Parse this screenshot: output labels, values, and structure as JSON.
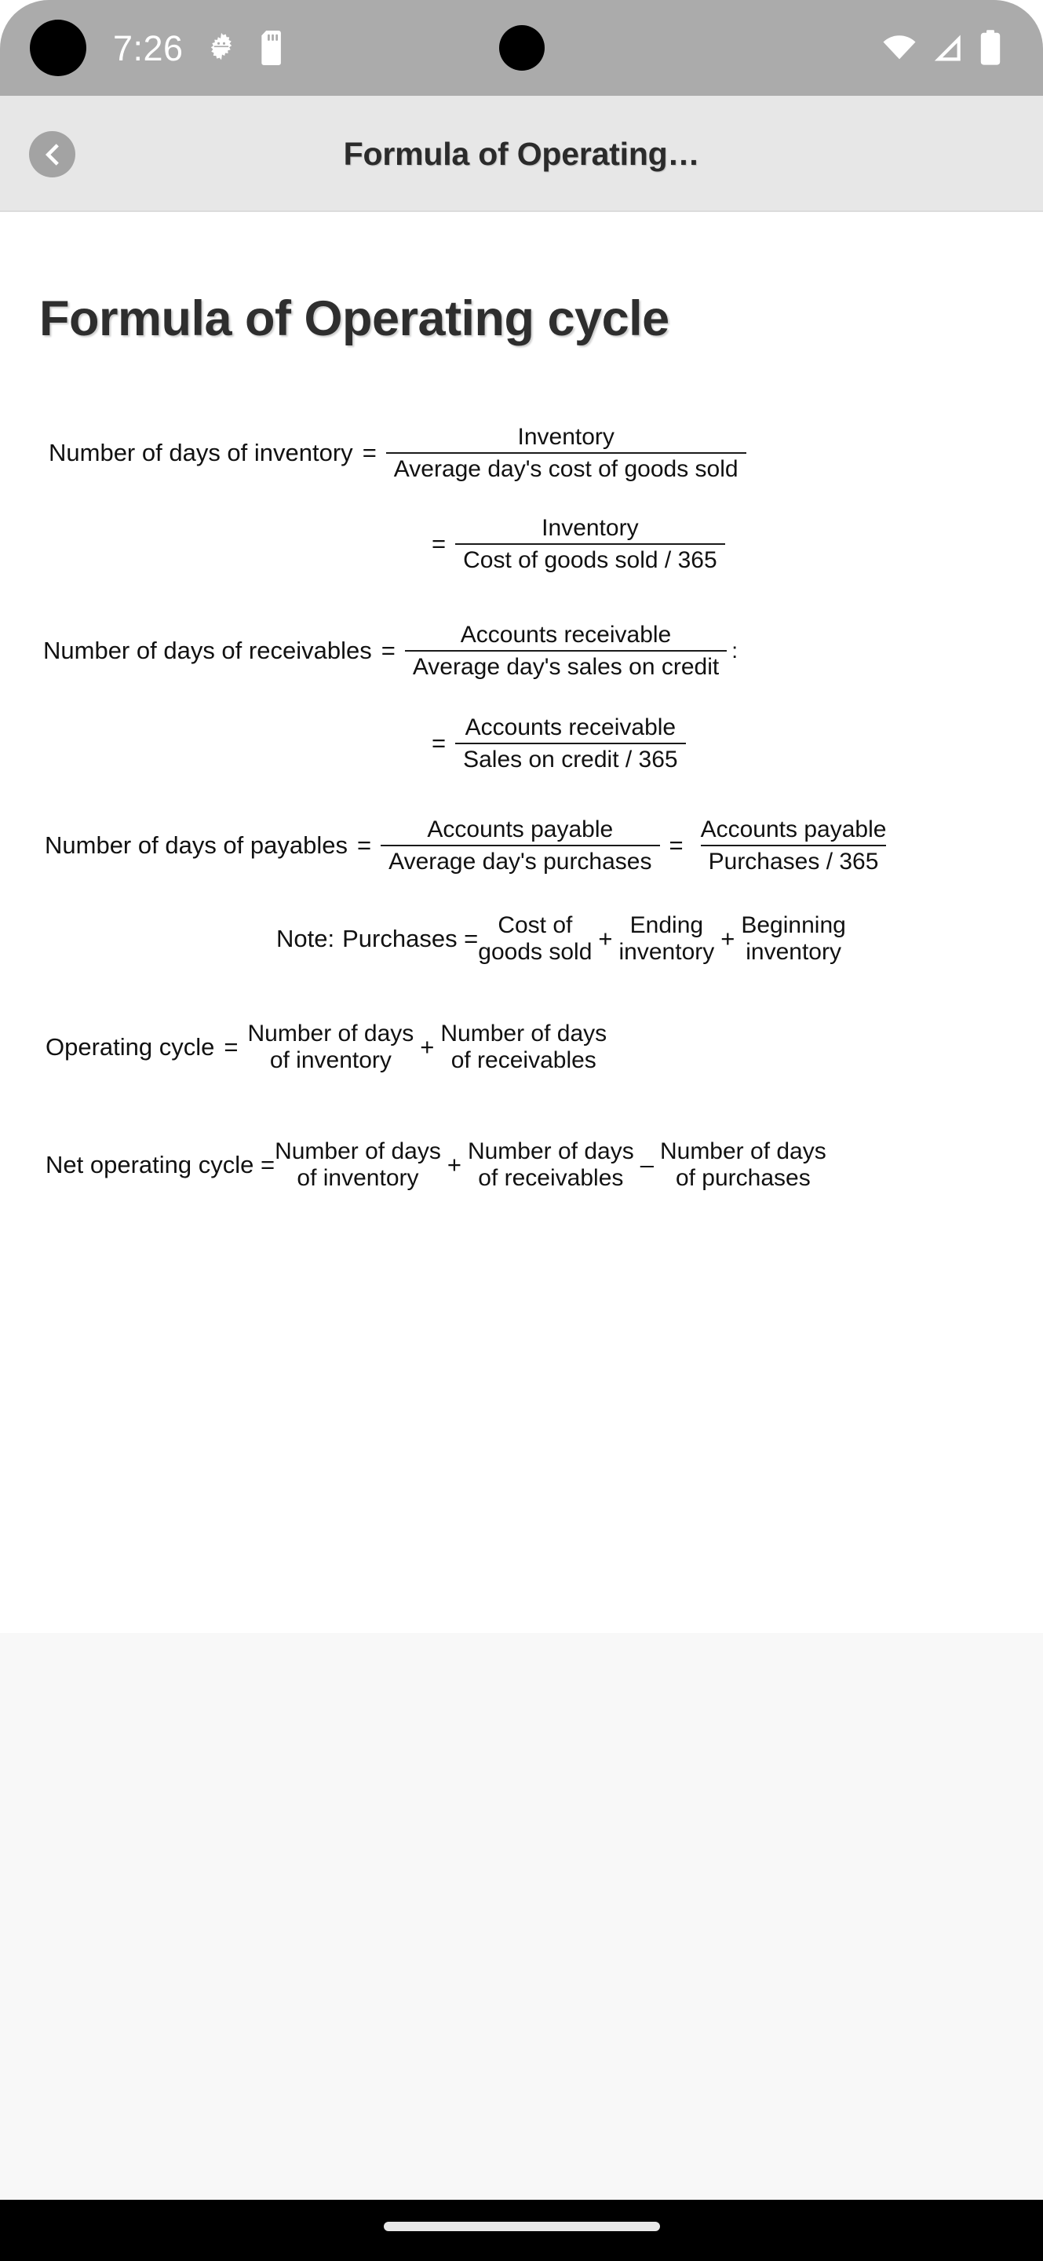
{
  "status_bar": {
    "clock": "7:26",
    "icons_left": [
      "android-debug-icon",
      "sd-card-icon"
    ],
    "icons_right": [
      "wifi-icon",
      "cellular-signal-icon",
      "battery-icon"
    ],
    "background_color": "#ababab"
  },
  "app_bar": {
    "title": "Formula of Operating…",
    "back_icon": "chevron-left-icon",
    "background_color": "#e7e7e7"
  },
  "content": {
    "page_title": "Formula of Operating cycle",
    "formulas": {
      "days_inventory": {
        "label": "Number of days of inventory",
        "equals": "=",
        "fraction1": {
          "numerator": "Inventory",
          "denominator": "Average day's cost of goods sold"
        },
        "fraction2": {
          "equals": "=",
          "numerator": "Inventory",
          "denominator": "Cost of goods sold / 365"
        }
      },
      "days_receivables": {
        "label": "Number of days of receivables",
        "equals": "=",
        "trailing_mark": ":",
        "fraction1": {
          "numerator": "Accounts receivable",
          "denominator": "Average day's sales on credit"
        },
        "fraction2": {
          "equals": "=",
          "numerator": "Accounts receivable",
          "denominator": "Sales on credit / 365"
        }
      },
      "days_payables": {
        "label": "Number of days of payables",
        "equals": "=",
        "fraction1": {
          "numerator": "Accounts payable",
          "denominator": "Average day's purchases"
        },
        "equals2": "=",
        "fraction2": {
          "numerator": "Accounts payable",
          "denominator": "Purchases / 365"
        }
      },
      "note_purchases": {
        "note_label": "Note:",
        "label": "Purchases =",
        "term1_line1": "Cost of",
        "term1_line2": "goods sold",
        "op1": "+",
        "term2_line1": "Ending",
        "term2_line2": "inventory",
        "op2": "+",
        "term3_line1": "Beginning",
        "term3_line2": "inventory"
      },
      "operating_cycle": {
        "label": "Operating cycle",
        "equals": "=",
        "term1_line1": "Number of days",
        "term1_line2": "of inventory",
        "op1": "+",
        "term2_line1": "Number of days",
        "term2_line2": "of receivables"
      },
      "net_operating_cycle": {
        "label": "Net operating cycle =",
        "term1_line1": "Number of days",
        "term1_line2": "of inventory",
        "op1": "+",
        "term2_line1": "Number of days",
        "term2_line2": "of receivables",
        "op2": "–",
        "term3_line1": "Number of days",
        "term3_line2": "of purchases"
      }
    }
  },
  "nav_bar": {
    "gesture_handle": "home-gesture-pill",
    "background_color": "#000000"
  }
}
